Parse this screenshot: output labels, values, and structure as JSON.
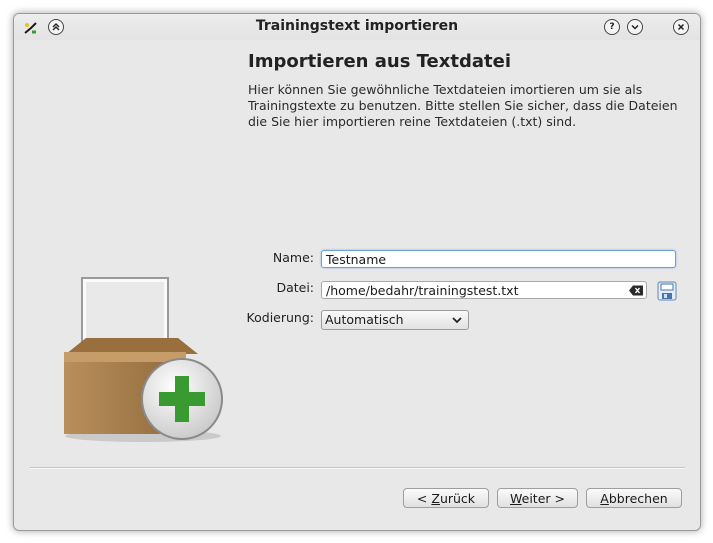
{
  "window": {
    "title": "Trainingstext importieren",
    "icons": [
      "app-icon",
      "keep-above-icon",
      "help-icon",
      "minimize-icon",
      "close-icon"
    ]
  },
  "page": {
    "heading": "Importieren aus Textdatei",
    "description": "Hier können Sie gewöhnliche Textdateien imortieren um sie als Trainingstexte zu benutzen. Bitte stellen Sie sicher, dass die Dateien die Sie hier importieren reine Textdateien (.txt) sind."
  },
  "form": {
    "name_label": "Name:",
    "name_value": "Testname",
    "file_label": "Datei:",
    "file_value": "/home/bedahr/trainingstest.txt",
    "encoding_label": "Kodierung:",
    "encoding_value": "Automatisch"
  },
  "buttons": {
    "back_prefix": "< ",
    "back_mnemonic": "Z",
    "back_rest": "urück",
    "next_mnemonic": "W",
    "next_rest": "eiter >",
    "cancel_mnemonic": "A",
    "cancel_rest": "bbrechen"
  },
  "colors": {
    "accent_green": "#3a9a32",
    "box_brown": "#b08654",
    "focus_blue": "#6ea2d6",
    "window_bg": "#e8e8e8"
  }
}
